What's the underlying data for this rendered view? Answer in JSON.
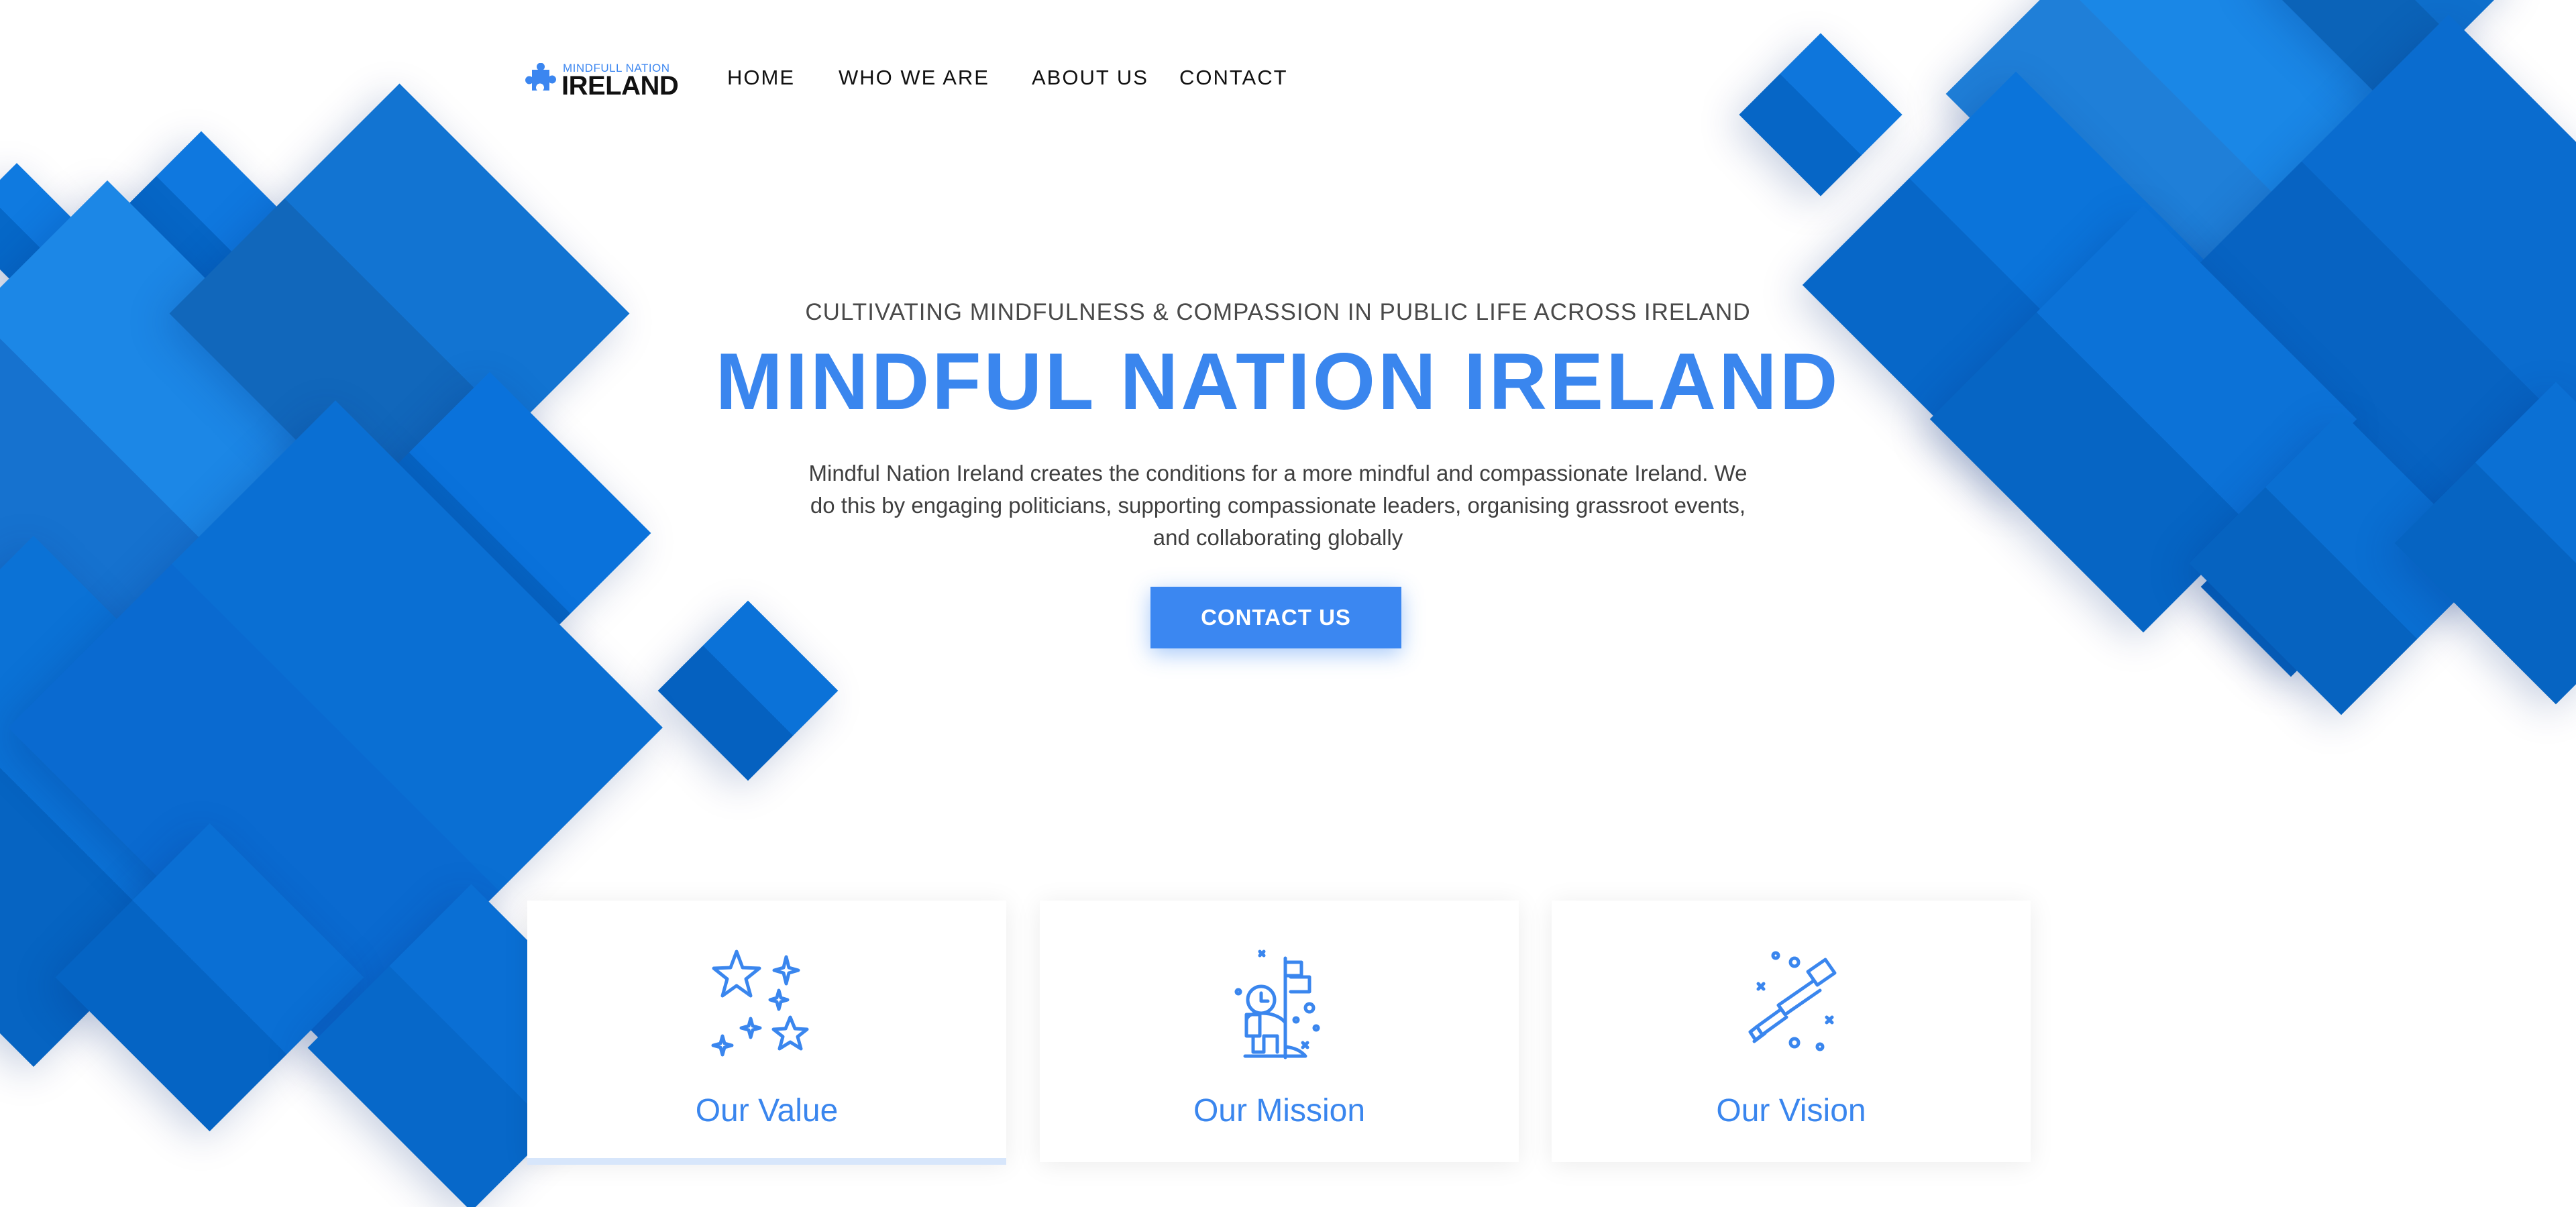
{
  "brand": {
    "tagline_small": "MINDFULL NATION",
    "name": "IRELAND",
    "primary_color": "#3b87f1",
    "icon": "puzzle-piece-icon"
  },
  "nav": {
    "items": [
      {
        "label": "HOME"
      },
      {
        "label": "WHO WE ARE"
      },
      {
        "label": "ABOUT US"
      },
      {
        "label": "CONTACT"
      }
    ]
  },
  "hero": {
    "subtitle": "CULTIVATING MINDFULNESS & COMPASSION IN PUBLIC LIFE ACROSS IRELAND",
    "title": "MINDFUL NATION IRELAND",
    "description": "Mindful Nation Ireland creates the conditions for a more mindful and compassionate Ireland. We do this by engaging politicians, supporting compassionate leaders, organising grassroot events, and collaborating globally",
    "cta_label": "CONTACT US"
  },
  "cards": [
    {
      "title": "Our Value",
      "icon": "stars-icon",
      "active": true
    },
    {
      "title": "Our Mission",
      "icon": "astronaut-flag-icon",
      "active": false
    },
    {
      "title": "Our Vision",
      "icon": "telescope-icon",
      "active": false
    }
  ],
  "colors": {
    "accent_text": "#3a86ee",
    "diamond_light": "#1a86e6",
    "diamond_mid": "#0d72d6",
    "diamond_dark": "#0664c0"
  }
}
